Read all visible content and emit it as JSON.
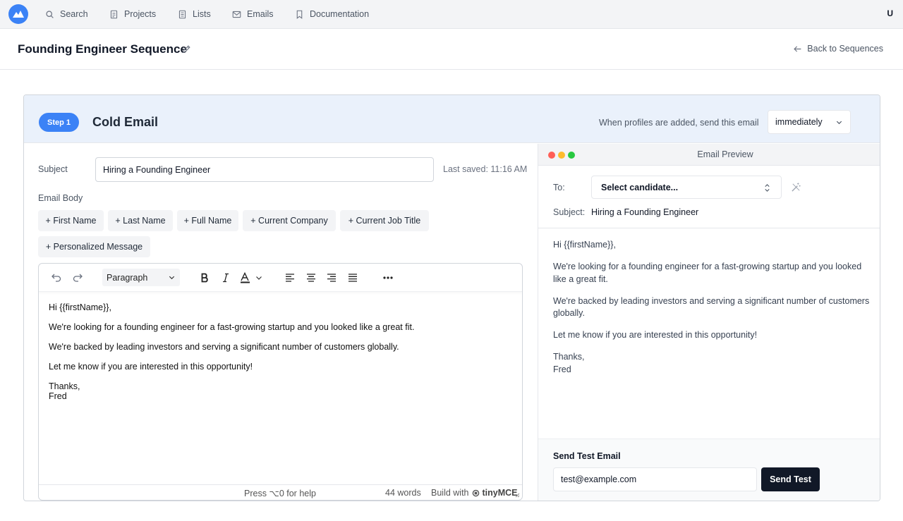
{
  "nav": {
    "items": [
      {
        "label": "Search",
        "icon": "search-icon"
      },
      {
        "label": "Projects",
        "icon": "document-icon"
      },
      {
        "label": "Lists",
        "icon": "list-icon"
      },
      {
        "label": "Emails",
        "icon": "mail-icon"
      },
      {
        "label": "Documentation",
        "icon": "bookmark-icon"
      }
    ],
    "user_initial": "U"
  },
  "header": {
    "title": "Founding Engineer Sequence",
    "back_label": "Back to Sequences"
  },
  "step": {
    "badge": "Step 1",
    "title": "Cold Email",
    "send_label": "When profiles are added, send this email",
    "send_timing": "immediately"
  },
  "editor": {
    "subject_label": "Subject",
    "subject_value": "Hiring a Founding Engineer",
    "last_saved": "Last saved: 11:16 AM",
    "body_label": "Email Body",
    "variables": [
      "+ First Name",
      "+ Last Name",
      "+ Full Name",
      "+ Current Company",
      "+ Current Job Title",
      "+ Personalized Message"
    ],
    "block_format": "Paragraph",
    "content": {
      "greeting": "Hi {{firstName}},",
      "p1": "We're looking for a founding engineer for a fast-growing startup and you looked like a great fit.",
      "p2": "We're backed by leading investors and serving a significant number of customers globally.",
      "p3": "Let me know if you are interested in this opportunity!",
      "signoff": "Thanks,",
      "signature": "Fred"
    },
    "status_help": "Press ⌥0 for help",
    "status_words": "44 words",
    "status_build": "Build with",
    "status_brand": "tinyMCE"
  },
  "preview": {
    "title": "Email Preview",
    "to_label": "To:",
    "candidate_placeholder": "Select candidate...",
    "subject_label": "Subject:",
    "subject_value": "Hiring a Founding Engineer",
    "greeting": "Hi {{firstName}},",
    "p1": "We're looking for a founding engineer for a fast-growing startup and you looked like a great fit.",
    "p2": "We're backed by leading investors and serving a significant number of customers globally.",
    "p3": "Let me know if you are interested in this opportunity!",
    "signoff": "Thanks,",
    "signature": "Fred"
  },
  "test": {
    "label": "Send Test Email",
    "email_value": "test@example.com",
    "button_label": "Send Test"
  },
  "colors": {
    "accent": "#3b82f6",
    "header_bg": "#eaf1fb",
    "dark_button": "#111827",
    "dot_red": "#ff5f57",
    "dot_yellow": "#febc2e",
    "dot_green": "#28c840"
  }
}
